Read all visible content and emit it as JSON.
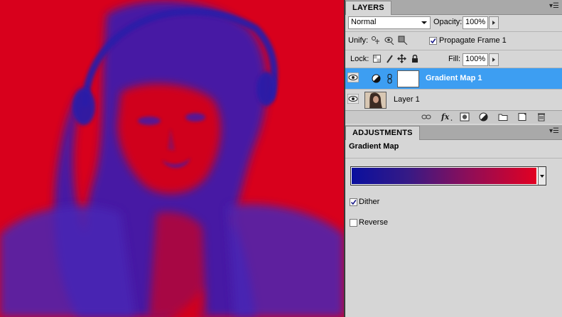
{
  "layers_panel": {
    "tab_label": "LAYERS",
    "blend_mode": "Normal",
    "opacity_label": "Opacity:",
    "opacity_value": "100%",
    "unify_label": "Unify:",
    "propagate_label": "Propagate Frame 1",
    "propagate_checked": true,
    "lock_label": "Lock:",
    "fill_label": "Fill:",
    "fill_value": "100%",
    "layers": [
      {
        "name": "Gradient Map 1",
        "type": "adjustment",
        "selected": true,
        "visible": true
      },
      {
        "name": "Layer 1",
        "type": "image",
        "selected": false,
        "visible": true
      }
    ],
    "bottom_icons": [
      "link-icon",
      "fx-icon",
      "mask-icon",
      "adjustment-icon",
      "folder-icon",
      "new-layer-icon",
      "trash-icon"
    ]
  },
  "adjustments_panel": {
    "tab_label": "ADJUSTMENTS",
    "title": "Gradient Map",
    "gradient_colors": [
      "#0a0f9e",
      "#e20022"
    ],
    "dither_label": "Dither",
    "dither_checked": true,
    "reverse_label": "Reverse",
    "reverse_checked": false
  },
  "canvas": {
    "duotone_colors": [
      "#d8001c",
      "#3a1db0"
    ]
  }
}
